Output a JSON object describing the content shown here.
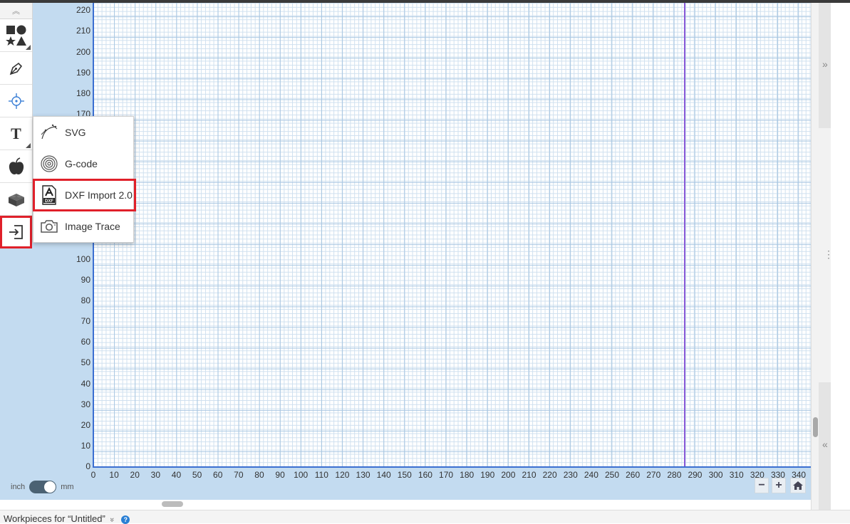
{
  "toolbar": {
    "collapse_icon": "chevrons-up-icon",
    "tools": [
      {
        "name": "shapes-tool",
        "icon": "shapes-icon"
      },
      {
        "name": "pen-tool",
        "icon": "pen-nib-icon"
      },
      {
        "name": "point-tool",
        "icon": "target-icon"
      },
      {
        "name": "text-tool",
        "icon": "text-icon"
      },
      {
        "name": "icon-library-tool",
        "icon": "apple-icon"
      },
      {
        "name": "parts-library-tool",
        "icon": "brick-icon"
      },
      {
        "name": "import-tool",
        "icon": "import-icon"
      }
    ]
  },
  "import_menu": {
    "items": [
      {
        "label": "SVG",
        "icon": "svg-curve-icon"
      },
      {
        "label": "G-code",
        "icon": "gcode-spiral-icon"
      },
      {
        "label": "DXF Import 2.0",
        "icon": "dxf-file-icon"
      },
      {
        "label": "Image Trace",
        "icon": "camera-icon"
      }
    ]
  },
  "axes": {
    "y_ticks": [
      "220",
      "210",
      "200",
      "190",
      "180",
      "170",
      "100",
      "90",
      "80",
      "70",
      "60",
      "50",
      "40",
      "30",
      "20",
      "10",
      "0"
    ],
    "x_ticks": [
      "0",
      "10",
      "20",
      "30",
      "40",
      "50",
      "60",
      "70",
      "80",
      "90",
      "100",
      "110",
      "120",
      "130",
      "140",
      "150",
      "160",
      "170",
      "180",
      "190",
      "200",
      "210",
      "220",
      "230",
      "240",
      "250",
      "260",
      "270",
      "280",
      "290",
      "300",
      "310",
      "320",
      "330",
      "340"
    ]
  },
  "units": {
    "left": "inch",
    "right": "mm"
  },
  "zoom": {
    "minus": "−",
    "plus": "+",
    "home_icon": "home-icon"
  },
  "right_panel": {
    "expand_icon": "double-chevron-right-icon",
    "handle_icon": "vertical-dots-icon",
    "collapse_icon": "double-chevron-left-icon",
    "expand_glyph": "»",
    "handle_glyph": "⋮",
    "collapse_glyph": "«"
  },
  "footer": {
    "label": "Workpieces for “Untitled”",
    "chevron": "»",
    "help": "?"
  },
  "colors": {
    "accent": "#3b6fd1",
    "highlight": "#e0202a",
    "machine_limit": "#8a5ad8",
    "workspace": "#c3dbf0"
  }
}
